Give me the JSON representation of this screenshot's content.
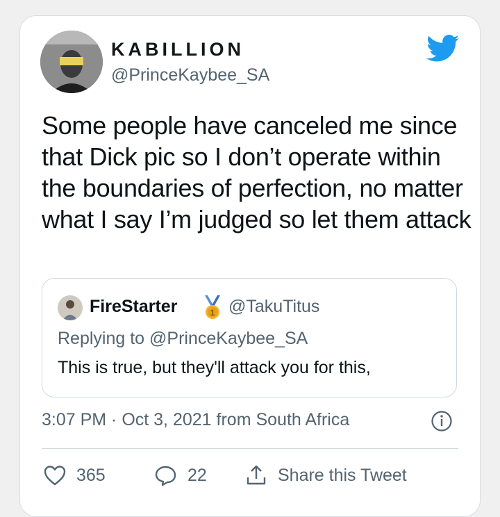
{
  "tweet": {
    "display_name": "KABILLION",
    "handle": "@PrinceKaybee_SA",
    "text": "Some people have canceled me since that Dick pic so I don’t operate within the boundaries of perfection, no matter what I say I’m judged so let them attack",
    "timestamp": "3:07 PM · Oct 3, 2021 from South Africa",
    "likes": "365",
    "replies": "22",
    "share_label": "Share this Tweet"
  },
  "quote": {
    "display_name": "FireStarter",
    "handle": "@TakuTitus",
    "replying_to": "Replying to @PrinceKaybee_SA",
    "text": "This is true, but they'll attack you for this,"
  },
  "colors": {
    "twitter_blue": "#1d9bf0",
    "secondary_text": "#536471",
    "border": "#cfd9de"
  },
  "icons": [
    "twitter-bird-icon",
    "info-icon",
    "heart-icon",
    "reply-bubble-icon",
    "share-icon",
    "medal-icon"
  ]
}
